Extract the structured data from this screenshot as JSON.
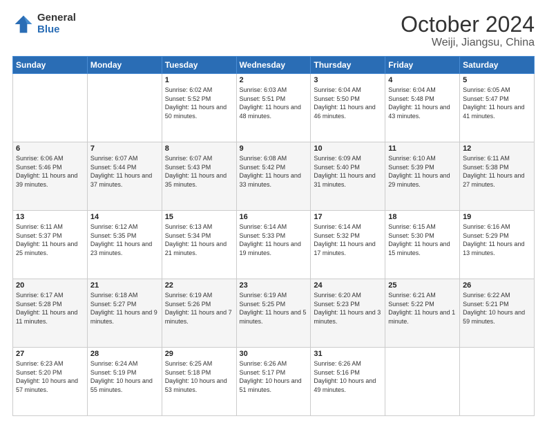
{
  "logo": {
    "general": "General",
    "blue": "Blue"
  },
  "header": {
    "title": "October 2024",
    "subtitle": "Weiji, Jiangsu, China"
  },
  "weekdays": [
    "Sunday",
    "Monday",
    "Tuesday",
    "Wednesday",
    "Thursday",
    "Friday",
    "Saturday"
  ],
  "weeks": [
    [
      {
        "day": "",
        "sunrise": "",
        "sunset": "",
        "daylight": ""
      },
      {
        "day": "",
        "sunrise": "",
        "sunset": "",
        "daylight": ""
      },
      {
        "day": "1",
        "sunrise": "Sunrise: 6:02 AM",
        "sunset": "Sunset: 5:52 PM",
        "daylight": "Daylight: 11 hours and 50 minutes."
      },
      {
        "day": "2",
        "sunrise": "Sunrise: 6:03 AM",
        "sunset": "Sunset: 5:51 PM",
        "daylight": "Daylight: 11 hours and 48 minutes."
      },
      {
        "day": "3",
        "sunrise": "Sunrise: 6:04 AM",
        "sunset": "Sunset: 5:50 PM",
        "daylight": "Daylight: 11 hours and 46 minutes."
      },
      {
        "day": "4",
        "sunrise": "Sunrise: 6:04 AM",
        "sunset": "Sunset: 5:48 PM",
        "daylight": "Daylight: 11 hours and 43 minutes."
      },
      {
        "day": "5",
        "sunrise": "Sunrise: 6:05 AM",
        "sunset": "Sunset: 5:47 PM",
        "daylight": "Daylight: 11 hours and 41 minutes."
      }
    ],
    [
      {
        "day": "6",
        "sunrise": "Sunrise: 6:06 AM",
        "sunset": "Sunset: 5:46 PM",
        "daylight": "Daylight: 11 hours and 39 minutes."
      },
      {
        "day": "7",
        "sunrise": "Sunrise: 6:07 AM",
        "sunset": "Sunset: 5:44 PM",
        "daylight": "Daylight: 11 hours and 37 minutes."
      },
      {
        "day": "8",
        "sunrise": "Sunrise: 6:07 AM",
        "sunset": "Sunset: 5:43 PM",
        "daylight": "Daylight: 11 hours and 35 minutes."
      },
      {
        "day": "9",
        "sunrise": "Sunrise: 6:08 AM",
        "sunset": "Sunset: 5:42 PM",
        "daylight": "Daylight: 11 hours and 33 minutes."
      },
      {
        "day": "10",
        "sunrise": "Sunrise: 6:09 AM",
        "sunset": "Sunset: 5:40 PM",
        "daylight": "Daylight: 11 hours and 31 minutes."
      },
      {
        "day": "11",
        "sunrise": "Sunrise: 6:10 AM",
        "sunset": "Sunset: 5:39 PM",
        "daylight": "Daylight: 11 hours and 29 minutes."
      },
      {
        "day": "12",
        "sunrise": "Sunrise: 6:11 AM",
        "sunset": "Sunset: 5:38 PM",
        "daylight": "Daylight: 11 hours and 27 minutes."
      }
    ],
    [
      {
        "day": "13",
        "sunrise": "Sunrise: 6:11 AM",
        "sunset": "Sunset: 5:37 PM",
        "daylight": "Daylight: 11 hours and 25 minutes."
      },
      {
        "day": "14",
        "sunrise": "Sunrise: 6:12 AM",
        "sunset": "Sunset: 5:35 PM",
        "daylight": "Daylight: 11 hours and 23 minutes."
      },
      {
        "day": "15",
        "sunrise": "Sunrise: 6:13 AM",
        "sunset": "Sunset: 5:34 PM",
        "daylight": "Daylight: 11 hours and 21 minutes."
      },
      {
        "day": "16",
        "sunrise": "Sunrise: 6:14 AM",
        "sunset": "Sunset: 5:33 PM",
        "daylight": "Daylight: 11 hours and 19 minutes."
      },
      {
        "day": "17",
        "sunrise": "Sunrise: 6:14 AM",
        "sunset": "Sunset: 5:32 PM",
        "daylight": "Daylight: 11 hours and 17 minutes."
      },
      {
        "day": "18",
        "sunrise": "Sunrise: 6:15 AM",
        "sunset": "Sunset: 5:30 PM",
        "daylight": "Daylight: 11 hours and 15 minutes."
      },
      {
        "day": "19",
        "sunrise": "Sunrise: 6:16 AM",
        "sunset": "Sunset: 5:29 PM",
        "daylight": "Daylight: 11 hours and 13 minutes."
      }
    ],
    [
      {
        "day": "20",
        "sunrise": "Sunrise: 6:17 AM",
        "sunset": "Sunset: 5:28 PM",
        "daylight": "Daylight: 11 hours and 11 minutes."
      },
      {
        "day": "21",
        "sunrise": "Sunrise: 6:18 AM",
        "sunset": "Sunset: 5:27 PM",
        "daylight": "Daylight: 11 hours and 9 minutes."
      },
      {
        "day": "22",
        "sunrise": "Sunrise: 6:19 AM",
        "sunset": "Sunset: 5:26 PM",
        "daylight": "Daylight: 11 hours and 7 minutes."
      },
      {
        "day": "23",
        "sunrise": "Sunrise: 6:19 AM",
        "sunset": "Sunset: 5:25 PM",
        "daylight": "Daylight: 11 hours and 5 minutes."
      },
      {
        "day": "24",
        "sunrise": "Sunrise: 6:20 AM",
        "sunset": "Sunset: 5:23 PM",
        "daylight": "Daylight: 11 hours and 3 minutes."
      },
      {
        "day": "25",
        "sunrise": "Sunrise: 6:21 AM",
        "sunset": "Sunset: 5:22 PM",
        "daylight": "Daylight: 11 hours and 1 minute."
      },
      {
        "day": "26",
        "sunrise": "Sunrise: 6:22 AM",
        "sunset": "Sunset: 5:21 PM",
        "daylight": "Daylight: 10 hours and 59 minutes."
      }
    ],
    [
      {
        "day": "27",
        "sunrise": "Sunrise: 6:23 AM",
        "sunset": "Sunset: 5:20 PM",
        "daylight": "Daylight: 10 hours and 57 minutes."
      },
      {
        "day": "28",
        "sunrise": "Sunrise: 6:24 AM",
        "sunset": "Sunset: 5:19 PM",
        "daylight": "Daylight: 10 hours and 55 minutes."
      },
      {
        "day": "29",
        "sunrise": "Sunrise: 6:25 AM",
        "sunset": "Sunset: 5:18 PM",
        "daylight": "Daylight: 10 hours and 53 minutes."
      },
      {
        "day": "30",
        "sunrise": "Sunrise: 6:26 AM",
        "sunset": "Sunset: 5:17 PM",
        "daylight": "Daylight: 10 hours and 51 minutes."
      },
      {
        "day": "31",
        "sunrise": "Sunrise: 6:26 AM",
        "sunset": "Sunset: 5:16 PM",
        "daylight": "Daylight: 10 hours and 49 minutes."
      },
      {
        "day": "",
        "sunrise": "",
        "sunset": "",
        "daylight": ""
      },
      {
        "day": "",
        "sunrise": "",
        "sunset": "",
        "daylight": ""
      }
    ]
  ]
}
